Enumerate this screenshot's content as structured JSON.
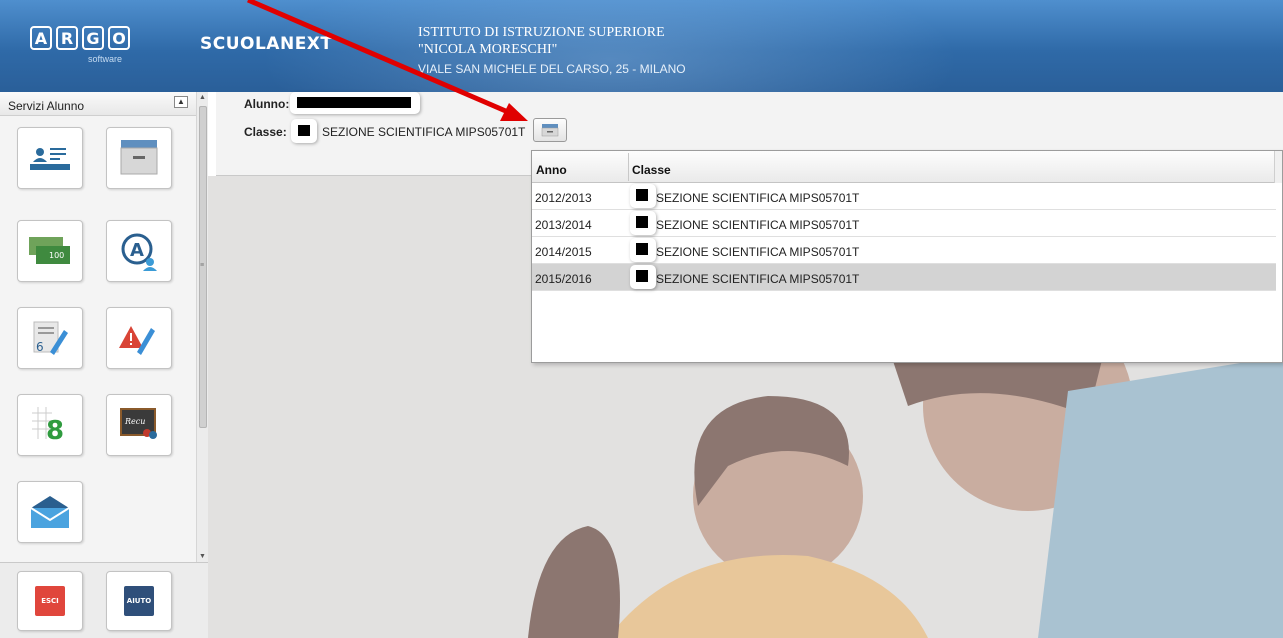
{
  "header": {
    "logo_letters": [
      "A",
      "R",
      "G",
      "O"
    ],
    "logo_sub": "software",
    "brand": "SCUOLANEXT",
    "school_line1": "ISTITUTO DI ISTRUZIONE SUPERIORE",
    "school_line2": "\"NICOLA MORESCHI\"",
    "school_address": "VIALE SAN MICHELE DEL CARSO, 25 - MILANO"
  },
  "sidebar": {
    "title": "Servizi Alunno",
    "tiles": [
      {
        "name": "tile-anagrafica",
        "icon": "id-card-icon"
      },
      {
        "name": "tile-archivio",
        "icon": "drawer-icon"
      },
      {
        "name": "tile-tasse",
        "icon": "banknotes-icon",
        "label": "100"
      },
      {
        "name": "tile-assenze",
        "icon": "absence-icon",
        "label": "A"
      },
      {
        "name": "tile-voti-giornalieri",
        "icon": "grade-edit-icon",
        "label": "6"
      },
      {
        "name": "tile-note-disciplinari",
        "icon": "warning-edit-icon"
      },
      {
        "name": "tile-voti-scrutinio",
        "icon": "grade-grid-icon",
        "label": "8"
      },
      {
        "name": "tile-recupero",
        "icon": "blackboard-icon",
        "label": "Recu"
      },
      {
        "name": "tile-bacheca",
        "icon": "mail-icon"
      }
    ],
    "exit_label": "ESCI",
    "help_label": "AIUTO"
  },
  "student": {
    "alunno_label": "Alunno:",
    "classe_label": "Classe:",
    "classe_value": "SEZIONE SCIENTIFICA MIPS05701T"
  },
  "grid": {
    "columns": [
      "Anno",
      "Classe"
    ],
    "rows": [
      {
        "anno": "2012/2013",
        "classe": "SEZIONE SCIENTIFICA MIPS05701T"
      },
      {
        "anno": "2013/2014",
        "classe": "SEZIONE SCIENTIFICA MIPS05701T"
      },
      {
        "anno": "2014/2015",
        "classe": "SEZIONE SCIENTIFICA MIPS05701T"
      },
      {
        "anno": "2015/2016",
        "classe": "SEZIONE SCIENTIFICA MIPS05701T",
        "selected": true
      }
    ]
  },
  "colors": {
    "header": "#2f6aa8",
    "selected_row": "#d3d3d3",
    "arrow": "#e00000",
    "exit": "#e0463c",
    "help": "#2f4f7a"
  }
}
